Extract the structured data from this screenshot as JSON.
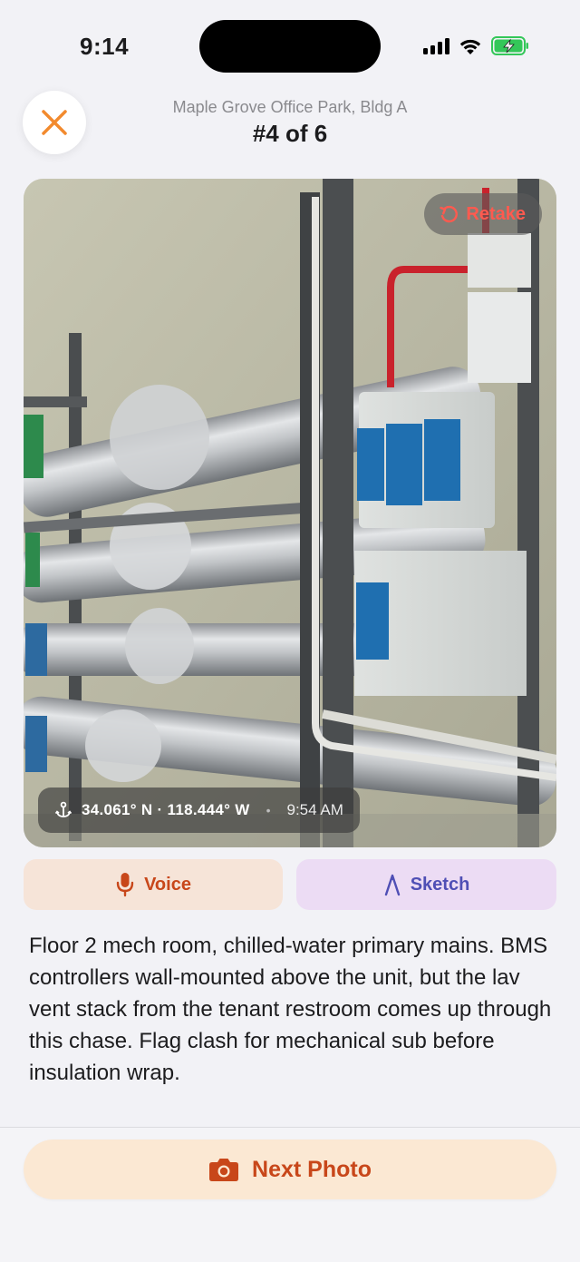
{
  "status_bar": {
    "time": "9:14",
    "icons": [
      "signal-icon",
      "wifi-icon",
      "battery-charging-icon"
    ]
  },
  "header": {
    "subtitle": "Maple Grove Office Park, Bldg A",
    "title": "#4 of 6",
    "close_icon": "close-icon"
  },
  "photo": {
    "description_icon": "photo",
    "retake_label": "Retake",
    "location": {
      "coords": "34.061° N · 118.444° W",
      "separator": "•",
      "time": "9:54 AM"
    }
  },
  "actions": {
    "voice_label": "Voice",
    "sketch_label": "Sketch"
  },
  "note": {
    "text": "Floor 2 mech room, chilled-water primary mains. BMS controllers wall-mounted above the unit, but the lav vent stack from the tenant restroom comes up through this chase. Flag clash for mechanical sub before insulation wrap."
  },
  "bottom": {
    "next_photo_label": "Next Photo"
  },
  "colors": {
    "accent_orange": "#c8471a",
    "close_orange": "#f28a2e",
    "retake_red": "#ff5a4f",
    "sketch_purple": "#4f4fb5",
    "battery_green": "#34c759"
  }
}
